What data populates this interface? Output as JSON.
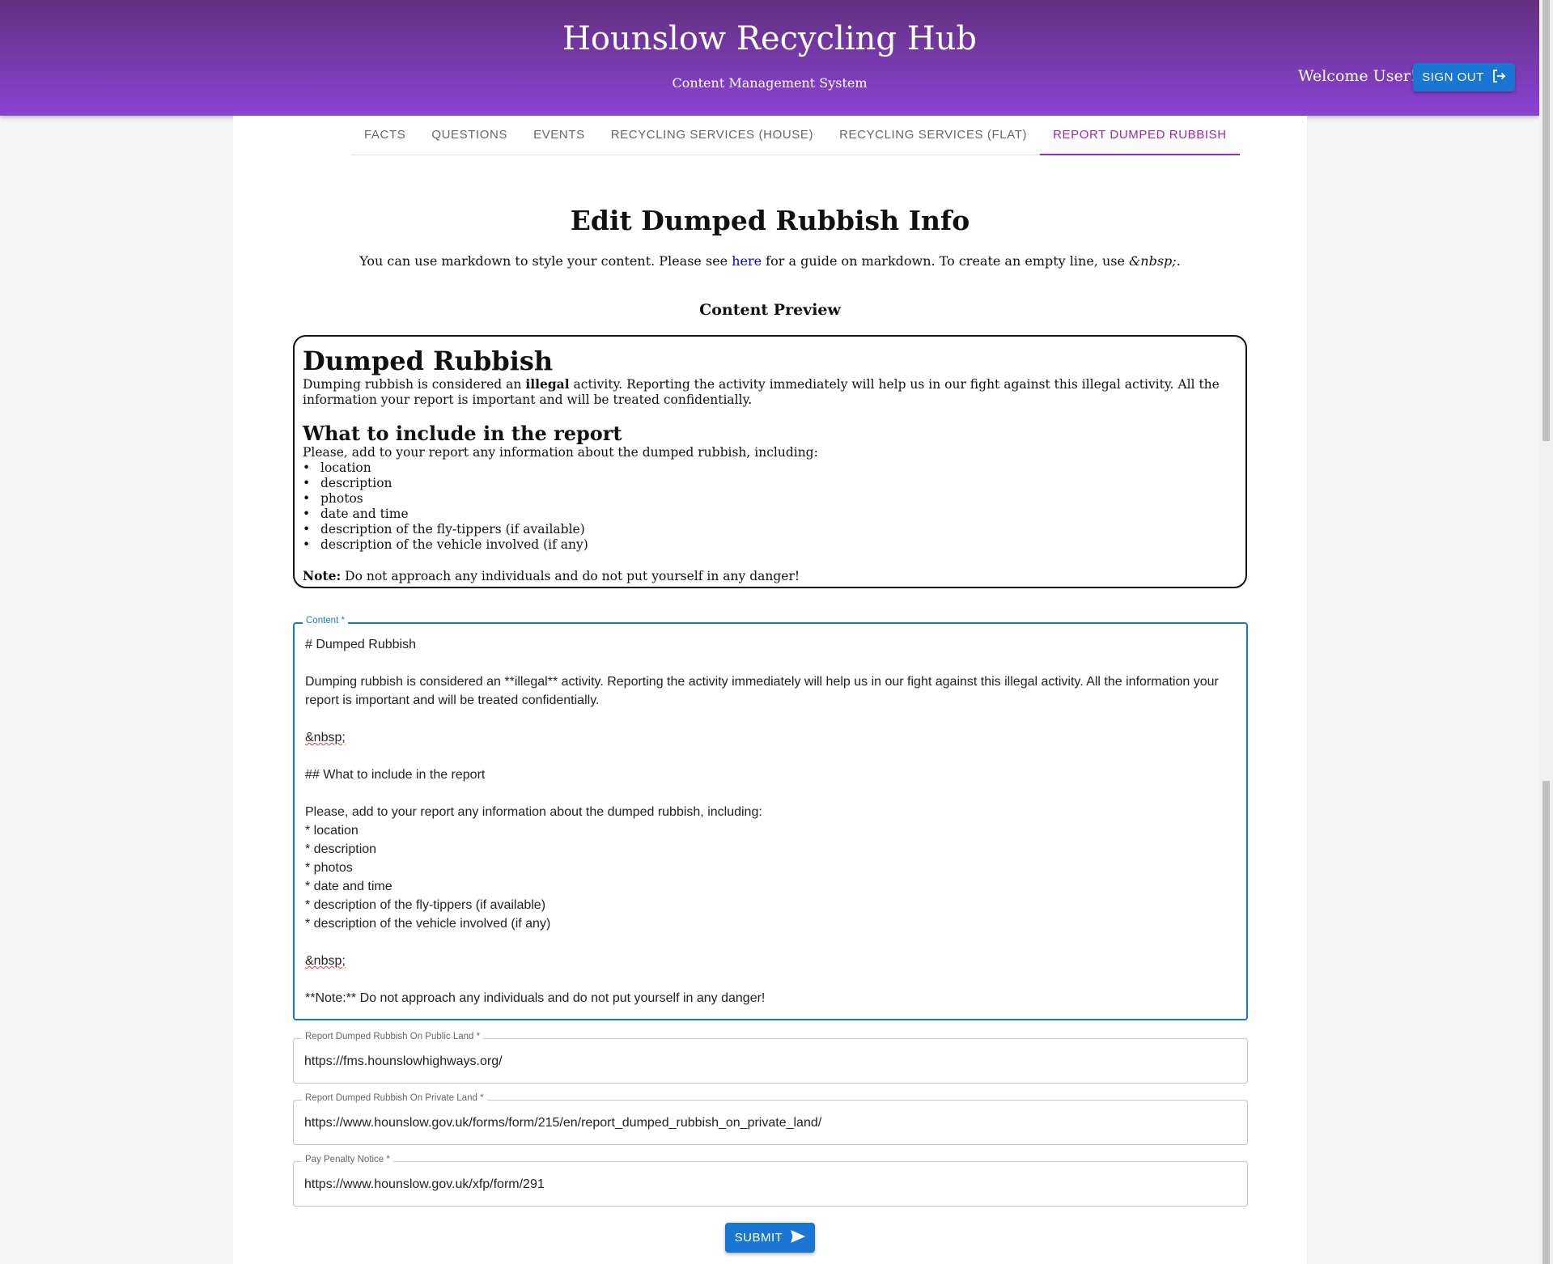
{
  "header": {
    "title": "Hounslow Recycling Hub",
    "subtitle": "Content Management System",
    "welcome": "Welcome User!",
    "signout_label": "SIGN OUT",
    "signout_icon": "logout-icon"
  },
  "tabs": [
    {
      "label": "FACTS",
      "active": false
    },
    {
      "label": "QUESTIONS",
      "active": false
    },
    {
      "label": "EVENTS",
      "active": false
    },
    {
      "label": "RECYCLING SERVICES (HOUSE)",
      "active": false
    },
    {
      "label": "RECYCLING SERVICES (FLAT)",
      "active": false
    },
    {
      "label": "REPORT DUMPED RUBBISH",
      "active": true
    }
  ],
  "page": {
    "title": "Edit Dumped Rubbish Info",
    "intro_before": "You can use markdown to style your content. Please see ",
    "intro_link": "here",
    "intro_after": " for a guide on markdown. To create an empty line, use ",
    "intro_code": "&nbsp;",
    "intro_end": ".",
    "preview_heading": "Content Preview"
  },
  "preview": {
    "h1": "Dumped Rubbish",
    "p1_before": "Dumping rubbish is considered an ",
    "p1_bold": "illegal",
    "p1_after": " activity. Reporting the activity immediately will help us in our fight against this illegal activity. All the information your report is important and will be treated confidentially.",
    "h2": "What to include in the report",
    "p2": "Please, add to your report any information about the dumped rubbish, including:",
    "list": [
      "location",
      "description",
      "photos",
      "date and time",
      "description of the fly-tippers (if available)",
      "description of the vehicle involved (if any)"
    ],
    "note_bold": "Note:",
    "note_text": " Do not approach any individuals and do not put yourself in any danger!"
  },
  "content_field": {
    "label": "Content *",
    "lines": {
      "l1": "# Dumped Rubbish",
      "l2": "Dumping rubbish is considered an **illegal** activity. Reporting the activity immediately will help us in our fight against this illegal activity. All the information your report is important and will be treated confidentially.",
      "nbsp": "&nbsp;",
      "l4": "## What to include in the report",
      "l5": "Please, add to your report any information about the dumped rubbish, including:",
      "b1": "* location",
      "b2": "* description",
      "b3": "* photos",
      "b4": "* date and time",
      "b5": "* description of the fly-tippers (if available)",
      "b6": "* description of the vehicle involved (if any)",
      "last": "**Note:** Do not approach any individuals and do not put yourself in any danger!"
    }
  },
  "public_land": {
    "label": "Report Dumped Rubbish On Public Land *",
    "value": "https://fms.hounslowhighways.org/"
  },
  "private_land": {
    "label": "Report Dumped Rubbish On Private Land *",
    "value": "https://www.hounslow.gov.uk/forms/form/215/en/report_dumped_rubbish_on_private_land/"
  },
  "penalty": {
    "label": "Pay Penalty Notice *",
    "value": "https://www.hounslow.gov.uk/xfp/form/291"
  },
  "submit": {
    "label": "SUBMIT",
    "icon": "send-icon"
  }
}
